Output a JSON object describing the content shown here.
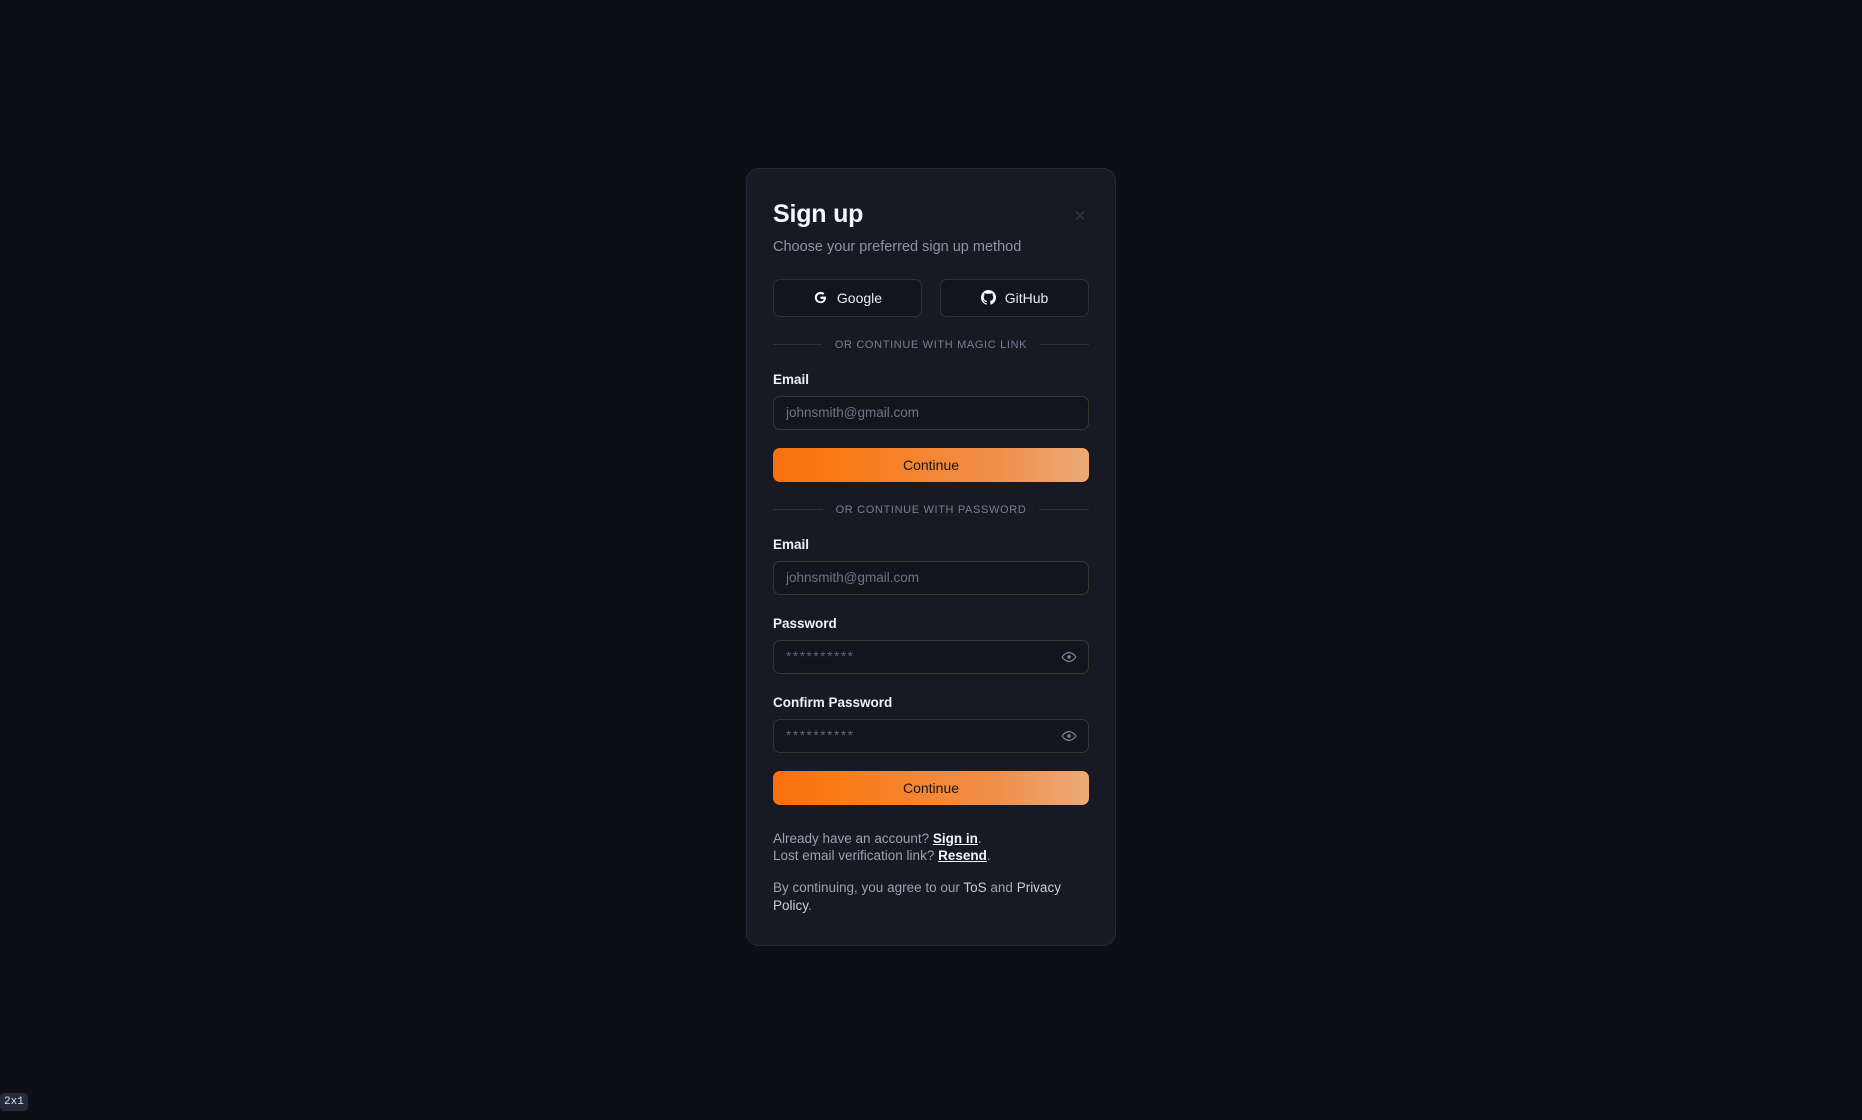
{
  "page": {
    "background_color": "#0d0f14",
    "corner_badge": "2x1"
  },
  "modal": {
    "title": "Sign up",
    "subtitle": "Choose your preferred sign up method",
    "close_label": "×",
    "background_color": "#171a23",
    "border_color": "#252a36"
  },
  "oauth": {
    "buttons": [
      {
        "label": "Google",
        "icon": "google-icon"
      },
      {
        "label": "GitHub",
        "icon": "github-icon"
      }
    ]
  },
  "magic_link": {
    "divider_label": "OR CONTINUE WITH MAGIC LINK",
    "email_label": "Email",
    "email_value": "",
    "email_placeholder": "johnsmith@gmail.com",
    "submit_label": "Continue"
  },
  "password_section": {
    "divider_label": "OR CONTINUE WITH PASSWORD",
    "email_label": "Email",
    "email_value": "",
    "email_placeholder": "johnsmith@gmail.com",
    "password_label": "Password",
    "password_value": "",
    "password_placeholder": "**********",
    "confirm_label": "Confirm Password",
    "confirm_value": "",
    "confirm_placeholder": "**********",
    "reveal_icon": "eye-icon",
    "submit_label": "Continue"
  },
  "footer": {
    "signin_prefix": "Already have an account? ",
    "signin_link": "Sign in",
    "signin_suffix": ".",
    "resend_prefix": "Lost email verification link? ",
    "resend_link": "Resend",
    "resend_suffix": ".",
    "legal_prefix": "By continuing, you agree to our ",
    "tos_link": "ToS",
    "legal_mid": " and ",
    "privacy_link": "Privacy Policy",
    "legal_suffix": "."
  },
  "colors": {
    "accent_start": "#f97010",
    "accent_end": "#edaa77",
    "input_bg": "#12151c",
    "input_border": "#3a3630"
  }
}
